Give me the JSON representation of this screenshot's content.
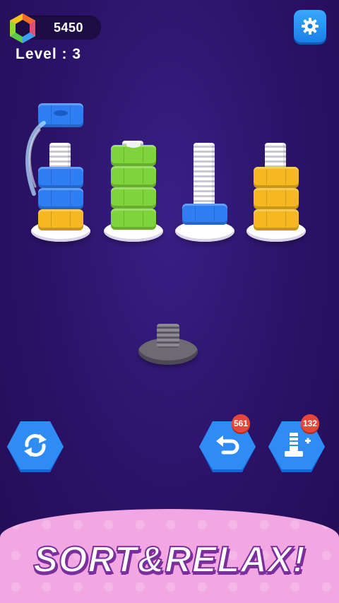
{
  "header": {
    "coins": "5450",
    "level_label": "Level : 3"
  },
  "icons": {
    "coin": "hexagon-coin-icon",
    "settings": "gear-icon",
    "shuffle": "refresh-icon",
    "undo": "undo-icon",
    "add_bolt": "bolt-plus-icon"
  },
  "board": {
    "bolts": [
      {
        "id": "bolt-1",
        "nuts": [
          "yellow",
          "blue",
          "blue"
        ],
        "lifted_nut": "blue"
      },
      {
        "id": "bolt-2",
        "nuts": [
          "green",
          "green",
          "green",
          "green"
        ]
      },
      {
        "id": "bolt-3",
        "nuts": [
          "blue"
        ]
      },
      {
        "id": "bolt-4",
        "nuts": [
          "yellow",
          "yellow",
          "yellow"
        ]
      }
    ],
    "empty_bolt": "grey"
  },
  "colors": {
    "blue": "#2f7df2",
    "green": "#7ed43a",
    "yellow": "#f6b820",
    "background": "#2a1266",
    "button": "#1a7fe8",
    "badge": "#e8463a"
  },
  "controls": {
    "undo_count": "561",
    "add_bolt_count": "132"
  },
  "banner": {
    "text": "SORT&RELAX!"
  }
}
